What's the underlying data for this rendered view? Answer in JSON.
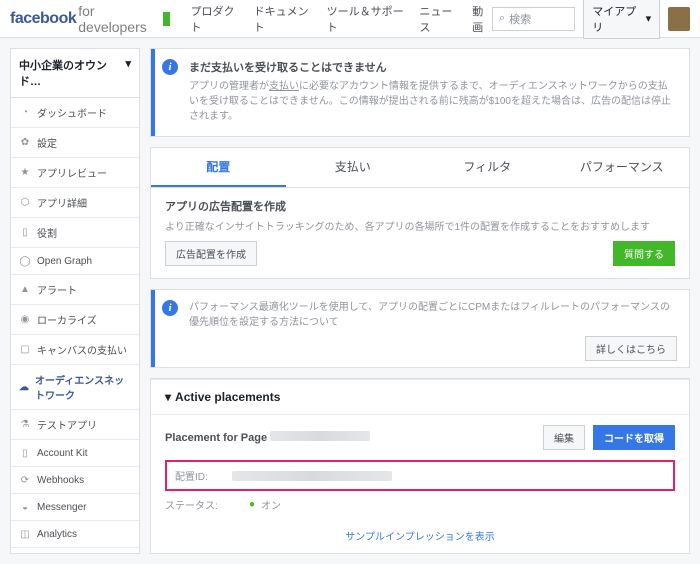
{
  "header": {
    "logo": "facebook",
    "logo_sub": "for developers",
    "nav": [
      "プロダクト",
      "ドキュメント",
      "ツール＆サポート",
      "ニュース",
      "動画"
    ],
    "search_placeholder": "検索",
    "myapp": "マイアプリ"
  },
  "sidebar": {
    "title": "中小企業のオウンド…",
    "items": [
      {
        "icon": "◔",
        "label": "ダッシュボード"
      },
      {
        "icon": "✿",
        "label": "設定"
      },
      {
        "icon": "★",
        "label": "アプリレビュー"
      },
      {
        "icon": "⬡",
        "label": "アプリ詳細"
      },
      {
        "icon": "▯",
        "label": "役割"
      },
      {
        "icon": "◯",
        "label": "Open Graph"
      },
      {
        "icon": "▲",
        "label": "アラート"
      },
      {
        "icon": "◉",
        "label": "ローカライズ"
      },
      {
        "icon": "▢",
        "label": "キャンバスの支払い"
      },
      {
        "icon": "☁",
        "label": "オーディエンスネットワーク",
        "active": true
      },
      {
        "icon": "⚗",
        "label": "テストアプリ"
      },
      {
        "icon": "▯",
        "label": "Account Kit"
      },
      {
        "icon": "⟳",
        "label": "Webhooks"
      },
      {
        "icon": "◒",
        "label": "Messenger"
      },
      {
        "icon": "◫",
        "label": "Analytics"
      }
    ]
  },
  "alerts": {
    "payout": {
      "title": "まだ支払いを受け取ることはできません",
      "text1": "アプリの管理者が",
      "text_u": "支払い",
      "text2": "に必要なアカウント情報を提供するまで、オーディエンスネットワークからの支払いを受け取ることはできません。この情報が提出される前に残高が$100を超えた場合は、広告の配信は停止されます。"
    },
    "perf": {
      "text": "パフォーマンス最適化ツールを使用して、アプリの配置ごとにCPMまたはフィルレートのパフォーマンスの優先順位を設定する方法について",
      "btn": "詳しくはこちら"
    }
  },
  "tabs": [
    "配置",
    "支払い",
    "フィルタ",
    "パフォーマンス"
  ],
  "section": {
    "title": "アプリの広告配置を作成",
    "desc": "より正確なインサイトトラッキングのため、各アプリの各場所で1件の配置を作成することをおすすめします",
    "create_btn": "広告配置を作成",
    "ask_btn": "質問する"
  },
  "placements": {
    "header": "Active placements",
    "name_prefix": "Placement for Page",
    "edit_btn": "編集",
    "code_btn": "コードを取得",
    "id_label": "配置ID:",
    "status_label": "ステータス:",
    "status_value": "オン",
    "sample_link": "サンプルインプレッションを表示"
  }
}
